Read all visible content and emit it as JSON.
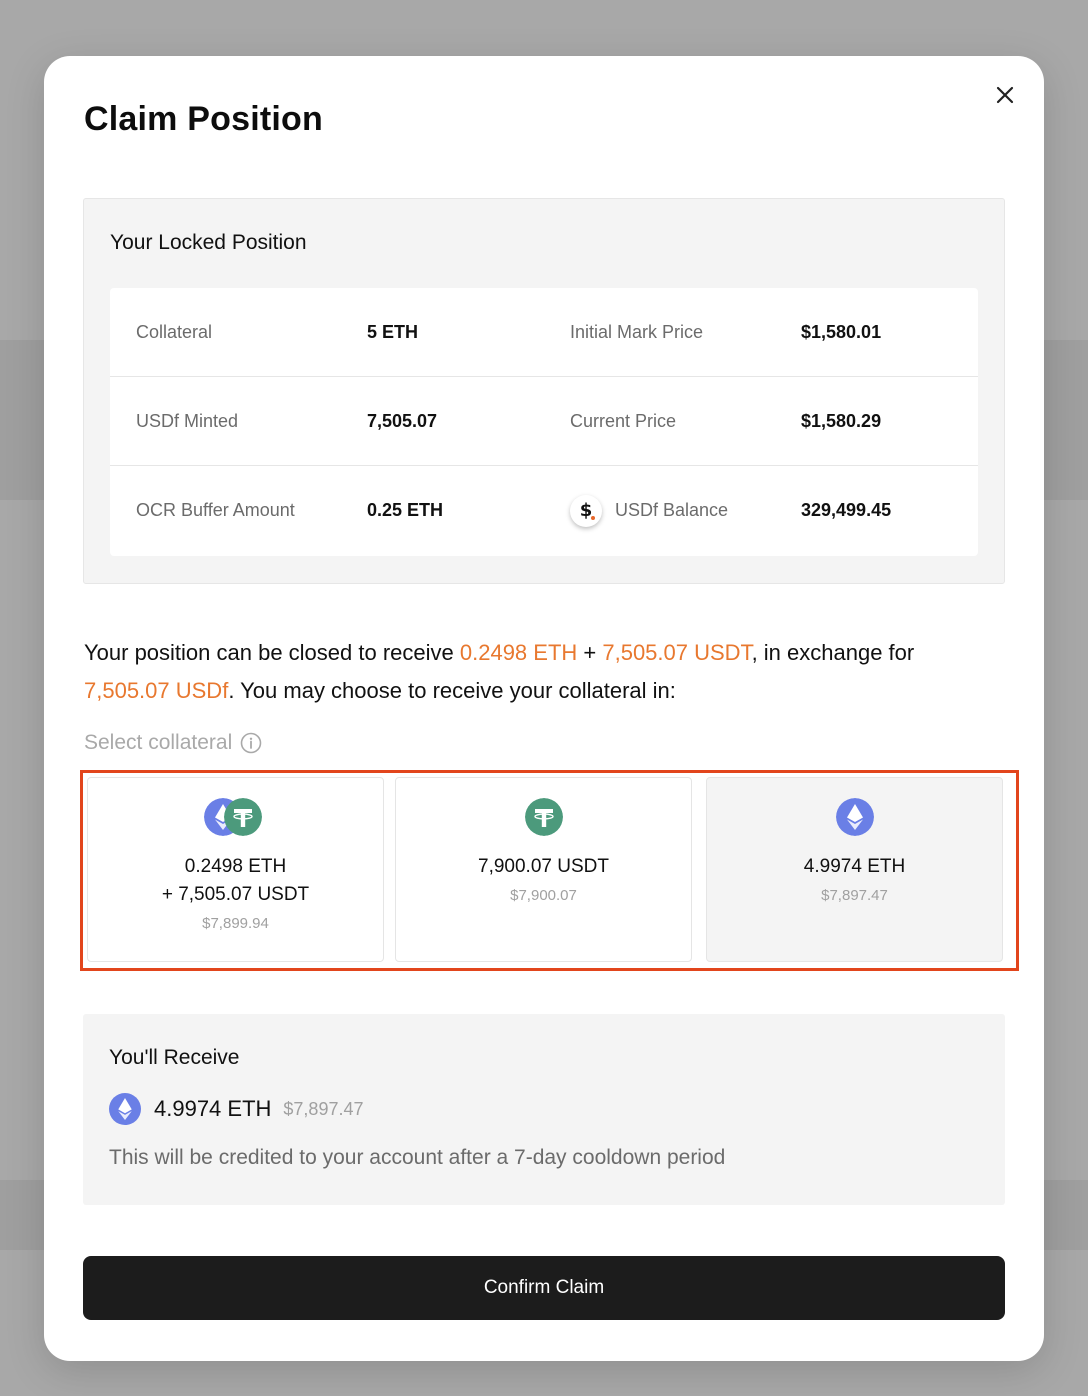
{
  "modal": {
    "title": "Claim Position",
    "close_icon": "close-icon"
  },
  "locked_position": {
    "title": "Your Locked Position",
    "rows": [
      {
        "left_label": "Collateral",
        "left_value": "5 ETH",
        "right_label": "Initial Mark Price",
        "right_value": "$1,580.01"
      },
      {
        "left_label": "USDf Minted",
        "left_value": "7,505.07",
        "right_label": "Current Price",
        "right_value": "$1,580.29"
      },
      {
        "left_label": "OCR Buffer Amount",
        "left_value": "0.25 ETH",
        "right_label": "USDf Balance",
        "right_value": "329,499.45",
        "right_icon": "usdf-coin-icon"
      }
    ]
  },
  "description": {
    "prefix": "Your position can be closed to receive ",
    "eth_amount": "0.2498 ETH",
    "plus": " + ",
    "usdt_amount": "7,505.07 USDT",
    "middle": ", in exchange for ",
    "usdf_amount": "7,505.07 USDf",
    "suffix": ". You may choose to receive your collateral in:"
  },
  "select_collateral": {
    "label": "Select collateral",
    "info_icon": "info-icon",
    "options": [
      {
        "line1": "0.2498 ETH",
        "line2": "+ 7,505.07 USDT",
        "usd": "$7,899.94",
        "icons": [
          "eth-icon",
          "usdt-icon"
        ]
      },
      {
        "line1": "7,900.07 USDT",
        "usd": "$7,900.07",
        "icons": [
          "usdt-icon"
        ]
      },
      {
        "line1": "4.9974 ETH",
        "usd": "$7,897.47",
        "icons": [
          "eth-icon"
        ],
        "selected": true
      }
    ]
  },
  "receive": {
    "title": "You'll Receive",
    "amount": "4.9974 ETH",
    "usd": "$7,897.47",
    "note": "This will be credited to your account after a 7-day cooldown period"
  },
  "confirm_button": {
    "label": "Confirm Claim"
  },
  "colors": {
    "accent_orange": "#e8782f",
    "selection_outline": "#e2451c",
    "eth_blue": "#6a7fe6",
    "usdt_green": "#4c9a7c",
    "button_dark": "#1c1c1c"
  }
}
